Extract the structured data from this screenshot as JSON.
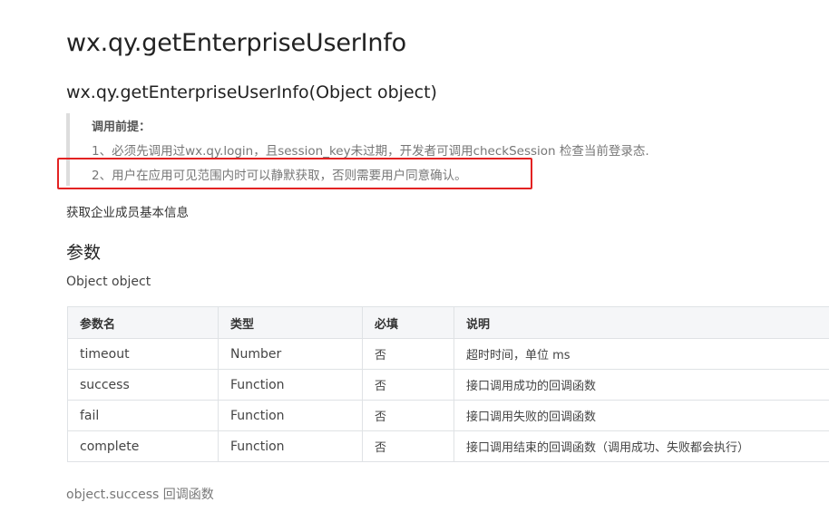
{
  "page": {
    "title": "wx.qy.getEnterpriseUserInfo",
    "signature": "wx.qy.getEnterpriseUserInfo(Object object)",
    "prerequisite": {
      "title": "调用前提：",
      "lines": [
        "1、必须先调用过wx.qy.login，且session_key未过期，开发者可调用checkSession 检查当前登录态.",
        "2、用户在应用可见范围内时可以静默获取，否则需要用户同意确认。"
      ]
    },
    "description": "获取企业成员基本信息",
    "params_heading": "参数",
    "object_label": "Object object",
    "footer": "object.success 回调函数"
  },
  "table": {
    "headers": [
      "参数名",
      "类型",
      "必填",
      "说明"
    ],
    "rows": [
      [
        "timeout",
        "Number",
        "否",
        "超时时间，单位 ms"
      ],
      [
        "success",
        "Function",
        "否",
        "接口调用成功的回调函数"
      ],
      [
        "fail",
        "Function",
        "否",
        "接口调用失败的回调函数"
      ],
      [
        "complete",
        "Function",
        "否",
        "接口调用结束的回调函数（调用成功、失败都会执行）"
      ]
    ]
  },
  "colors": {
    "highlight": "#e32222",
    "quote_border": "#dddddd",
    "table_header_bg": "#f5f6f8"
  }
}
